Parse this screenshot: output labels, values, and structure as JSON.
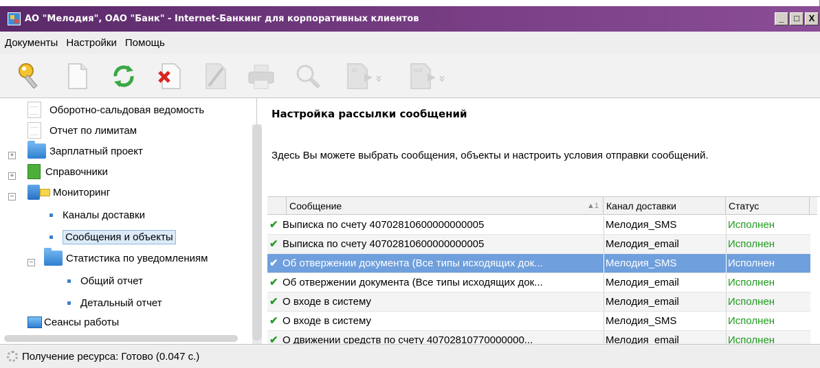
{
  "window": {
    "title": "АО \"Мелодия\", ОАО \"Банк\" - Internet-Банкинг для корпоративных клиентов",
    "minimize": "_",
    "maximize": "□",
    "close": "X"
  },
  "menu": [
    "Документы",
    "Настройки",
    "Помощь"
  ],
  "toolbar": {
    "icons": [
      "key-icon",
      "new-document-icon",
      "refresh-icon",
      "delete-icon",
      "edit-icon",
      "print-icon",
      "search-icon",
      "import-icon",
      "export-icon"
    ],
    "import_label": "in",
    "export_label": "out"
  },
  "tree": {
    "items": [
      {
        "label": "Оборотно-сальдовая ведомость",
        "icon": "document-icon"
      },
      {
        "label": "Отчет по лимитам",
        "icon": "document-icon"
      },
      {
        "label": "Зарплатный проект",
        "icon": "folder-icon",
        "expander": "+"
      },
      {
        "label": "Справочники",
        "icon": "book-icon",
        "expander": "+"
      },
      {
        "label": "Мониторинг",
        "icon": "monitor-icon",
        "expander": "−"
      },
      {
        "label": "Каналы доставки",
        "icon": "bullet"
      },
      {
        "label": "Сообщения и объекты",
        "icon": "bullet",
        "selected": true
      },
      {
        "label": "Статистика по уведомлениям",
        "icon": "folder-icon",
        "expander": "−"
      },
      {
        "label": "Общий отчет",
        "icon": "bullet"
      },
      {
        "label": "Детальный отчет",
        "icon": "bullet"
      },
      {
        "label": "Сеансы работы",
        "icon": "screen-icon"
      }
    ]
  },
  "content": {
    "heading": "Настройка рассылки сообщений",
    "description": "Здесь Вы можете выбрать сообщения, объекты и настроить условия отправки сообщений.",
    "columns": {
      "message": "Сообщение",
      "sort": "▲1",
      "channel": "Канал доставки",
      "status": "Статус"
    },
    "rows": [
      {
        "check": "✔",
        "message": "Выписка по счету 40702810600000000005",
        "channel": "Мелодия_SMS",
        "status": "Исполнен"
      },
      {
        "check": "✔",
        "message": "Выписка по счету 40702810600000000005",
        "channel": "Мелодия_email",
        "status": "Исполнен"
      },
      {
        "check": "✔",
        "message": "Об отвержении документа (Все типы исходящих док...",
        "channel": "Мелодия_SMS",
        "status": "Исполнен",
        "selected": true
      },
      {
        "check": "✔",
        "message": "Об отвержении документа (Все типы исходящих док...",
        "channel": "Мелодия_email",
        "status": "Исполнен"
      },
      {
        "check": "✔",
        "message": "О входе в систему",
        "channel": "Мелодия_email",
        "status": "Исполнен"
      },
      {
        "check": "✔",
        "message": "О входе в систему",
        "channel": "Мелодия_SMS",
        "status": "Исполнен"
      },
      {
        "check": "✔",
        "message": "О движении средств по счету 40702810770000000...",
        "channel": "Мелодия_email",
        "status": "Исполнен"
      }
    ]
  },
  "statusbar": {
    "text": "Получение ресурса: Готово (0.047 с.)"
  },
  "colors": {
    "titlebar": "#7a3f86",
    "selection": "#6f9fdc",
    "status_ok": "#1e9a1e"
  }
}
